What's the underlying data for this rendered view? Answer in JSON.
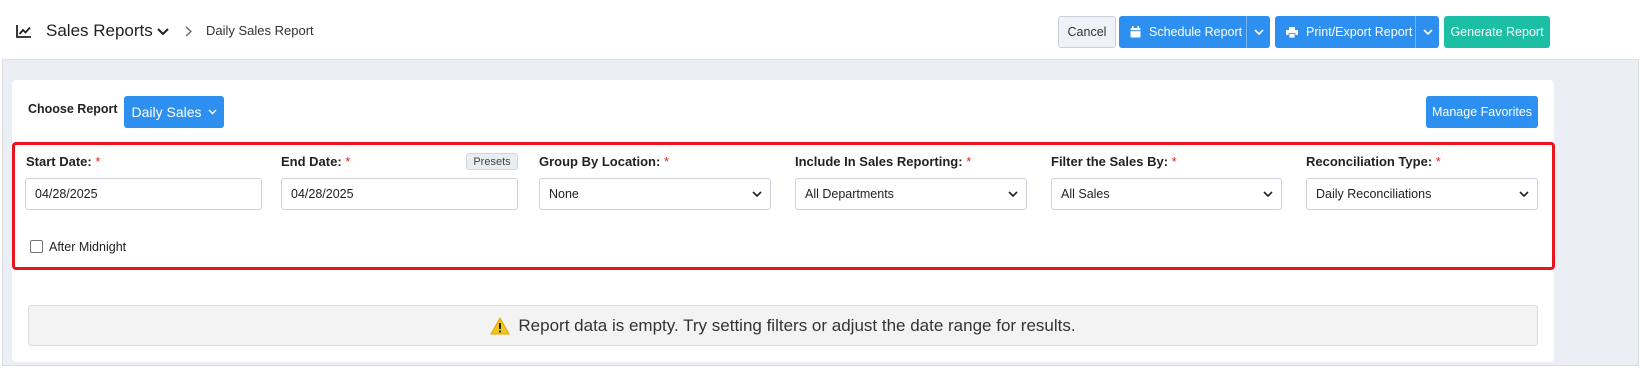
{
  "header": {
    "title": "Sales Reports",
    "breadcrumb": "Daily Sales Report",
    "cancel_label": "Cancel",
    "schedule_label": "Schedule Report",
    "print_label": "Print/Export Report",
    "generate_label": "Generate Report"
  },
  "report": {
    "choose_label": "Choose Report",
    "selected": "Daily Sales",
    "manage_favorites_label": "Manage Favorites"
  },
  "filters": {
    "start_date": {
      "label": "Start Date:",
      "value": "04/28/2025"
    },
    "end_date": {
      "label": "End Date:",
      "value": "04/28/2025",
      "presets_label": "Presets"
    },
    "group_by_location": {
      "label": "Group By Location:",
      "value": "None"
    },
    "include_in_sales": {
      "label": "Include In Sales Reporting:",
      "value": "All Departments"
    },
    "filter_sales_by": {
      "label": "Filter the Sales By:",
      "value": "All Sales"
    },
    "reconciliation_type": {
      "label": "Reconciliation Type:",
      "value": "Daily Reconciliations"
    },
    "required_mark": "*",
    "after_midnight": {
      "label": "After Midnight",
      "checked": false
    }
  },
  "alert": {
    "message": "Report data is empty. Try setting filters or adjust the date range for results."
  },
  "colors": {
    "primary": "#2d8ff0",
    "success": "#1cbfa4",
    "highlight": "#e8141e",
    "required": "#e02020",
    "warning": "#f5c518"
  },
  "icons": [
    "chart-line-icon",
    "chevron-down-icon",
    "breadcrumb-chevron-icon",
    "calendar-icon",
    "printer-icon",
    "warning-icon"
  ]
}
